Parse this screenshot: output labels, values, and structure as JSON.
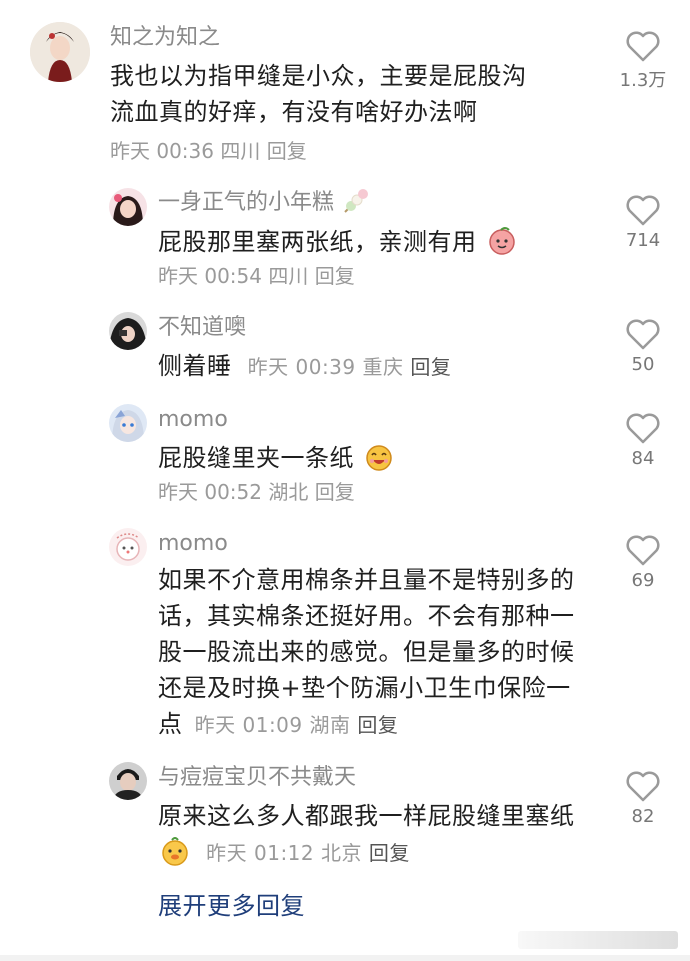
{
  "comments": [
    {
      "user": "知之为知之",
      "text": "我也以为指甲缝是小众，主要是屁股沟流血真的好痒，有没有啥好办法啊",
      "time": "昨天 00:36",
      "location": "四川",
      "reply": "回复",
      "likes": "1.3万"
    },
    {
      "user": "一身正气的小年糕",
      "text": "屁股那里塞两张纸，亲测有用",
      "time": "昨天 00:54",
      "location": "四川",
      "reply": "回复",
      "likes": "714"
    },
    {
      "user": "不知道噢",
      "text": "侧着睡",
      "time": "昨天 00:39",
      "location": "重庆",
      "reply": "回复",
      "likes": "50"
    },
    {
      "user": "momo",
      "text": "屁股缝里夹一条纸",
      "time": "昨天 00:52",
      "location": "湖北",
      "reply": "回复",
      "likes": "84"
    },
    {
      "user": "momo",
      "text": "如果不介意用棉条并且量不是特别多的话，其实棉条还挺好用。不会有那种一股一股流出来的感觉。但是量多的时候还是及时换+垫个防漏小卫生巾保险一点",
      "time": "昨天 01:09",
      "location": "湖南",
      "reply": "回复",
      "likes": "69"
    },
    {
      "user": "与痘痘宝贝不共戴天",
      "text": "原来这么多人都跟我一样屁股缝里塞纸",
      "time": "昨天 01:12",
      "location": "北京",
      "reply": "回复",
      "likes": "82"
    }
  ],
  "expand_label": "展开更多回复",
  "icons": {
    "like": "heart-outline-icon",
    "emoji_peach": "peach-emoji-icon",
    "emoji_grin": "grinning-face-emoji-icon",
    "emoji_duck": "duck-face-emoji-icon",
    "username_badge": "dango-sticker-icon"
  },
  "colors": {
    "username": "#8a8a8a",
    "meta": "#9a9a9a",
    "expand_link": "#1f3e7a",
    "text": "#1f1f1f"
  }
}
